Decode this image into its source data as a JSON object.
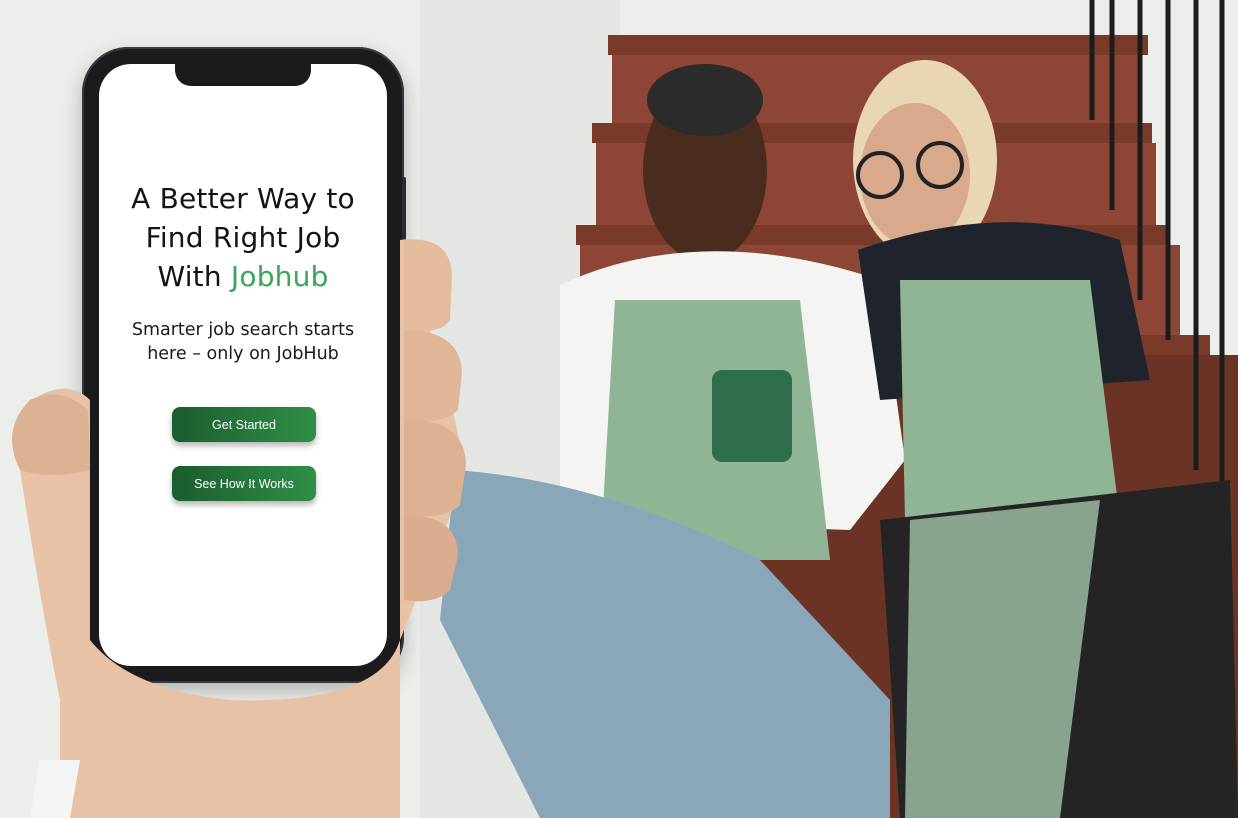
{
  "hero": {
    "headline_line1": "A Better Way to",
    "headline_line2": "Find Right Job",
    "headline_line3_prefix": "With ",
    "headline_brand": "Jobhub",
    "subtext": "Smarter job search starts here – only on JobHub",
    "primary_button": "Get Started",
    "secondary_button": "See How It Works"
  },
  "colors": {
    "brand_green": "#3aa65a",
    "button_dark_green": "#1a5c2e",
    "button_light_green": "#2f8f47"
  },
  "icons": {
    "phone_notch": "phone-notch-icon"
  }
}
